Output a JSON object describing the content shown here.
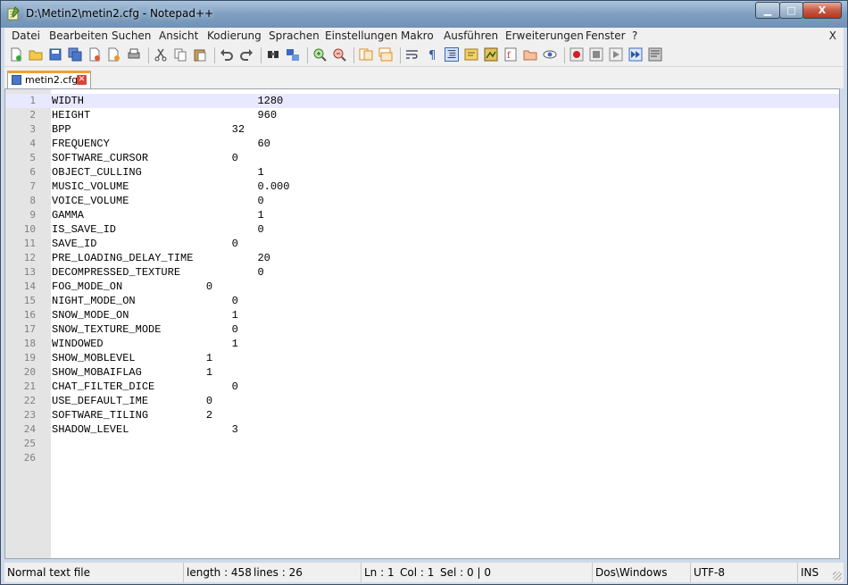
{
  "window": {
    "title": "D:\\Metin2\\metin2.cfg - Notepad++",
    "min_glyph": "▁",
    "max_glyph": "□",
    "close_glyph": "X"
  },
  "menu": [
    "Datei",
    "Bearbeiten",
    "Suchen",
    "Ansicht",
    "Kodierung",
    "Sprachen",
    "Einstellungen",
    "Makro",
    "Ausführen",
    "Erweiterungen",
    "Fenster",
    "?"
  ],
  "menu_close": "X",
  "toolbar_icons": [
    "new-file-icon",
    "open-file-icon",
    "save-icon",
    "save-all-icon",
    "close-icon",
    "close-all-icon",
    "print-icon",
    "cut-icon",
    "copy-icon",
    "paste-icon",
    "undo-icon",
    "redo-icon",
    "find-icon",
    "replace-icon",
    "zoom-in-icon",
    "zoom-out-icon",
    "sync-vertical-icon",
    "sync-horizontal-icon",
    "word-wrap-icon",
    "show-all-chars-icon",
    "indent-guide-icon",
    "user-lang-icon",
    "doc-map-icon",
    "function-list-icon",
    "folder-workspace-icon",
    "monitor-icon",
    "record-macro-icon",
    "stop-macro-icon",
    "play-macro-icon",
    "run-macro-multiple-icon",
    "save-macro-icon"
  ],
  "tab": {
    "label": "metin2.cfg",
    "close_glyph": "✕"
  },
  "lines": [
    {
      "n": "1",
      "text": "WIDTH                           1280"
    },
    {
      "n": "2",
      "text": "HEIGHT                          960"
    },
    {
      "n": "3",
      "text": "BPP                         32"
    },
    {
      "n": "4",
      "text": "FREQUENCY                       60"
    },
    {
      "n": "5",
      "text": "SOFTWARE_CURSOR             0"
    },
    {
      "n": "6",
      "text": "OBJECT_CULLING                  1"
    },
    {
      "n": "7",
      "text": "MUSIC_VOLUME                    0.000"
    },
    {
      "n": "8",
      "text": "VOICE_VOLUME                    0"
    },
    {
      "n": "9",
      "text": "GAMMA                           1"
    },
    {
      "n": "10",
      "text": "IS_SAVE_ID                      0"
    },
    {
      "n": "11",
      "text": "SAVE_ID                     0"
    },
    {
      "n": "12",
      "text": "PRE_LOADING_DELAY_TIME          20"
    },
    {
      "n": "13",
      "text": "DECOMPRESSED_TEXTURE            0"
    },
    {
      "n": "14",
      "text": "FOG_MODE_ON             0"
    },
    {
      "n": "15",
      "text": "NIGHT_MODE_ON               0"
    },
    {
      "n": "16",
      "text": "SNOW_MODE_ON                1"
    },
    {
      "n": "17",
      "text": "SNOW_TEXTURE_MODE           0"
    },
    {
      "n": "18",
      "text": "WINDOWED                    1"
    },
    {
      "n": "19",
      "text": "SHOW_MOBLEVEL           1"
    },
    {
      "n": "20",
      "text": "SHOW_MOBAIFLAG          1"
    },
    {
      "n": "21",
      "text": "CHAT_FILTER_DICE            0"
    },
    {
      "n": "22",
      "text": "USE_DEFAULT_IME         0"
    },
    {
      "n": "23",
      "text": "SOFTWARE_TILING         2"
    },
    {
      "n": "24",
      "text": "SHADOW_LEVEL                3"
    },
    {
      "n": "25",
      "text": ""
    },
    {
      "n": "26",
      "text": ""
    }
  ],
  "status": {
    "file_type": "Normal text file",
    "length": "length : 458",
    "lines": "lines : 26",
    "ln": "Ln : 1",
    "col": "Col : 1",
    "sel": "Sel : 0 | 0",
    "eol": "Dos\\Windows",
    "encoding": "UTF-8",
    "mode": "INS"
  }
}
